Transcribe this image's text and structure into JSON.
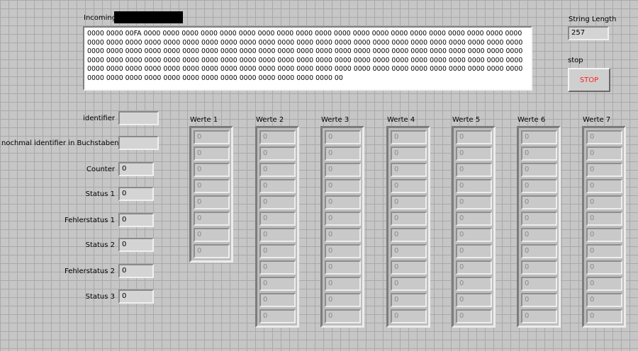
{
  "incoming": {
    "label": "Incoming",
    "text": "0000 0000 00FA 0000 0000 0000 0000 0000 0000 0000 0000 0000 0000 0000 0000 0000 0000 0000 0000 0000 0000 0000 0000 0000 0000 0000 0000 0000 0000 0000 0000 0000 0000 0000 0000 0000 0000 0000 0000 0000 0000 0000 0000 0000 0000 0000 0000 0000 0000 0000 0000 0000 0000 0000 0000 0000 0000 0000 0000 0000 0000 0000 0000 0000 0000 0000 0000 0000 0000 0000 0000 0000 0000 0000 0000 0000 0000 0000 0000 0000 0000 0000 0000 0000 0000 0000 0000 0000 0000 0000 0000 0000 0000 0000 0000 0000 0000 0000 0000 0000 0000 0000 0000 0000 0000 0000 0000 0000 0000 0000 0000 0000 0000 0000 0000 0000 0000 0000 0000 0000 0000 0000 0000 0000 0000 0000 0000 0000 00"
  },
  "string_length": {
    "label": "String Length",
    "value": "257"
  },
  "stop": {
    "label": "stop",
    "button": "STOP"
  },
  "fields": {
    "identifier": {
      "label": "identifier",
      "value": ""
    },
    "identifier_text": {
      "label": "nochmal identifier in Buchstaben",
      "value": ""
    },
    "counter": {
      "label": "Counter",
      "value": "0"
    },
    "status1": {
      "label": "Status 1",
      "value": "0"
    },
    "fehler1": {
      "label": "Fehlerstatus 1",
      "value": "0"
    },
    "status2": {
      "label": "Status 2",
      "value": "0"
    },
    "fehler2": {
      "label": "Fehlerstatus 2",
      "value": "0"
    },
    "status3": {
      "label": "Status 3",
      "value": "0"
    }
  },
  "werte": [
    {
      "label": "Werte 1",
      "values": [
        "0",
        "0",
        "0",
        "0",
        "0",
        "0",
        "0",
        "0"
      ]
    },
    {
      "label": "Werte 2",
      "values": [
        "0",
        "0",
        "0",
        "0",
        "0",
        "0",
        "0",
        "0",
        "0",
        "0",
        "0",
        "0"
      ]
    },
    {
      "label": "Werte 3",
      "values": [
        "0",
        "0",
        "0",
        "0",
        "0",
        "0",
        "0",
        "0",
        "0",
        "0",
        "0",
        "0"
      ]
    },
    {
      "label": "Werte 4",
      "values": [
        "0",
        "0",
        "0",
        "0",
        "0",
        "0",
        "0",
        "0",
        "0",
        "0",
        "0",
        "0"
      ]
    },
    {
      "label": "Werte 5",
      "values": [
        "0",
        "0",
        "0",
        "0",
        "0",
        "0",
        "0",
        "0",
        "0",
        "0",
        "0",
        "0"
      ]
    },
    {
      "label": "Werte 6",
      "values": [
        "0",
        "0",
        "0",
        "0",
        "0",
        "0",
        "0",
        "0",
        "0",
        "0",
        "0",
        "0"
      ]
    },
    {
      "label": "Werte 7",
      "values": [
        "0",
        "0",
        "0",
        "0",
        "0",
        "0",
        "0",
        "0",
        "0",
        "0",
        "0",
        "0"
      ]
    }
  ]
}
